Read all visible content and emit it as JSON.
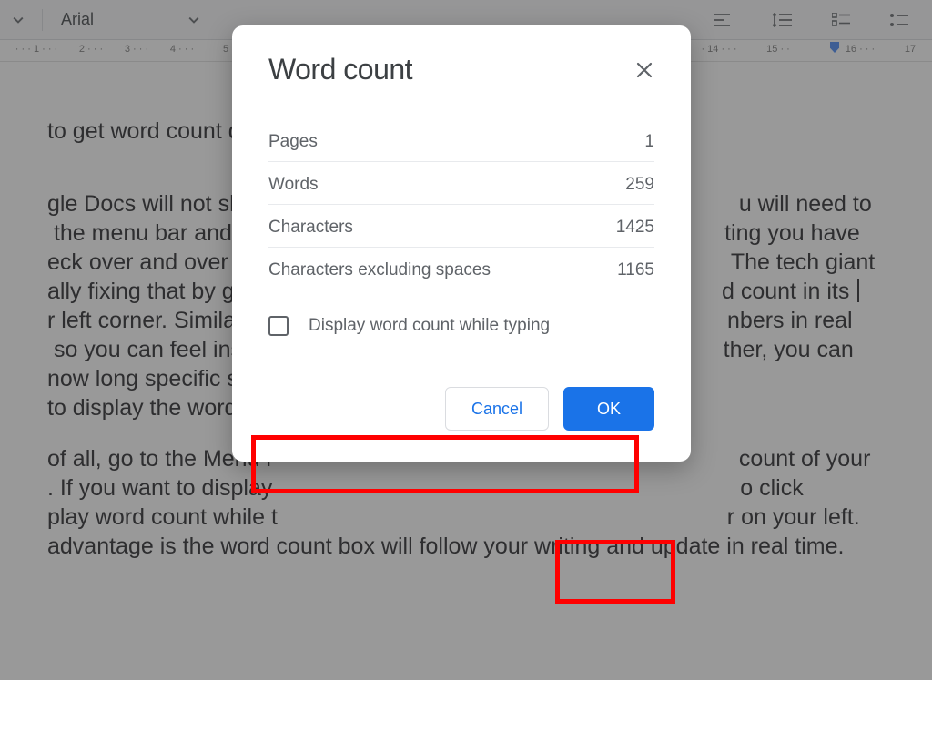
{
  "toolbar": {
    "font_name": "Arial"
  },
  "ruler": {
    "ticks": [
      1,
      2,
      3,
      4,
      5,
      14,
      15,
      16,
      17
    ],
    "blue_tab_at": 16
  },
  "document": {
    "heading": "to get word count disp",
    "para1": "gle Docs will not show                                                                         u will need to  the menu bar and che                                                                     ting you have eck over and over aga                                                                      The tech giant ally fixing that by giving                                                                       d count in its r left corner. Similar to                                                                        nbers in real  so you can feel instan                                                                     ther, you can now long specific secti to display the word co",
    "para2": "of all, go to the Menu                                                                         count of your . If you want to display                                                                      o click play word count while t                                                                      r on your left. advantage is the word count box will follow your writing and update in real time."
  },
  "modal": {
    "title": "Word count",
    "stats": {
      "pages_label": "Pages",
      "pages_value": "1",
      "words_label": "Words",
      "words_value": "259",
      "chars_label": "Characters",
      "chars_value": "1425",
      "chars_ns_label": "Characters excluding spaces",
      "chars_ns_value": "1165"
    },
    "checkbox_label": "Display word count while typing",
    "cancel_label": "Cancel",
    "ok_label": "OK"
  }
}
